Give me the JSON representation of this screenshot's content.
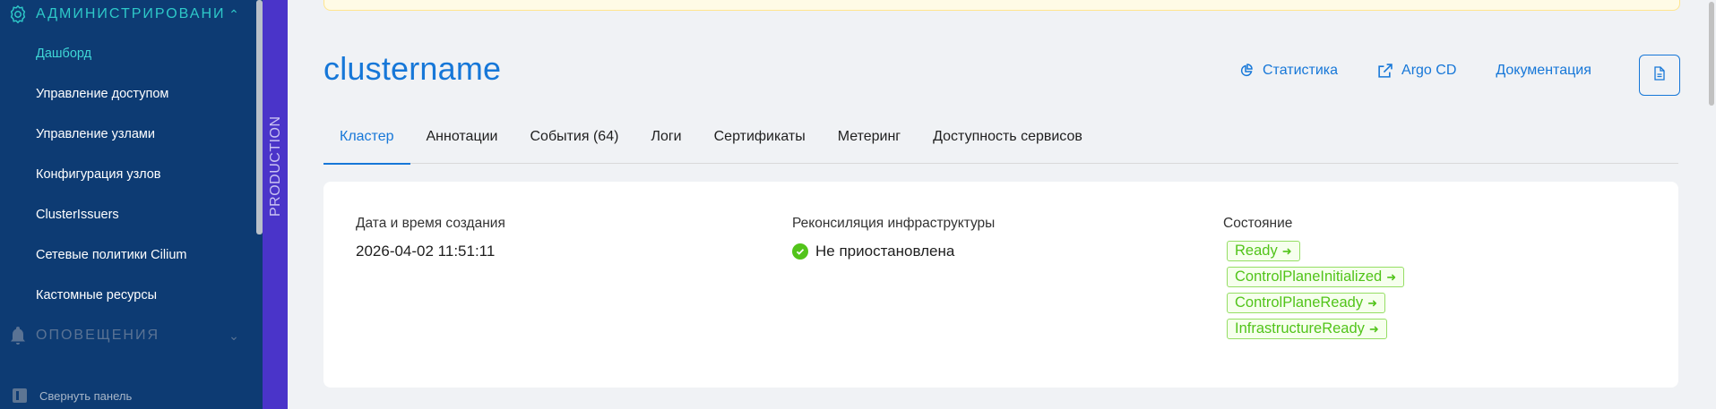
{
  "sidebar": {
    "admin_section": "Администрировани",
    "items": [
      {
        "label": "Дашборд",
        "active": true
      },
      {
        "label": "Управление доступом"
      },
      {
        "label": "Управление узлами"
      },
      {
        "label": "Конфигурация узлов"
      },
      {
        "label": "ClusterIssuers"
      },
      {
        "label": "Сетевые политики Cilium"
      },
      {
        "label": "Кастомные ресурсы"
      }
    ],
    "alerts_section": "Оповещения",
    "collapse_label": "Свернуть панель"
  },
  "environment": "PRODUCTION",
  "header": {
    "title": "clustername",
    "actions": {
      "stats": "Статистика",
      "argo": "Argo CD",
      "docs": "Документация"
    }
  },
  "tabs": [
    "Кластер",
    "Аннотации",
    "События (64)",
    "Логи",
    "Сертификаты",
    "Метеринг",
    "Доступность сервисов"
  ],
  "card": {
    "created_label": "Дата и время создания",
    "created_value": "2026-04-02 11:51:11",
    "recon_label": "Реконсиляция инфраструктуры",
    "recon_value": "Не приостановлена",
    "state_label": "Состояние",
    "states": [
      "Ready",
      "ControlPlaneInitialized",
      "ControlPlaneReady",
      "InfrastructureReady"
    ]
  },
  "colors": {
    "sidebar_bg": "#0d3b73",
    "accent": "#1677d8",
    "env_bar": "#4a34c9",
    "success": "#52c41a"
  }
}
